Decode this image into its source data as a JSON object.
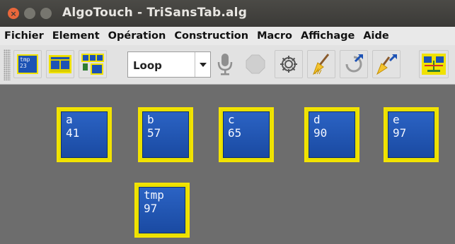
{
  "window": {
    "title": "AlgoTouch - TriSansTab.alg",
    "close_glyph": "×",
    "min_glyph": "",
    "max_glyph": ""
  },
  "menu": [
    "Fichier",
    "Element",
    "Opération",
    "Construction",
    "Macro",
    "Affichage",
    "Aide"
  ],
  "toolbar": {
    "new_variable_icon": "variable-tile-icon",
    "new_variable_text": "tmp\n23",
    "loop_select_value": "Loop",
    "icons": [
      "variable-tile-icon",
      "array-tile-icon",
      "array-index-icon",
      "microphone-icon",
      "stop-octagon-icon",
      "gear-icon",
      "broom-icon",
      "undo-icon",
      "broom-redo-icon",
      "scale-icon"
    ]
  },
  "variables": [
    {
      "name": "a",
      "value": "41"
    },
    {
      "name": "b",
      "value": "57"
    },
    {
      "name": "c",
      "value": "65"
    },
    {
      "name": "d",
      "value": "90"
    },
    {
      "name": "e",
      "value": "97"
    },
    {
      "name": "tmp",
      "value": "97"
    }
  ],
  "colors": {
    "tile_border": "#f3e300",
    "tile_fill": "#2158b8",
    "canvas_bg": "#6d6d6d"
  }
}
